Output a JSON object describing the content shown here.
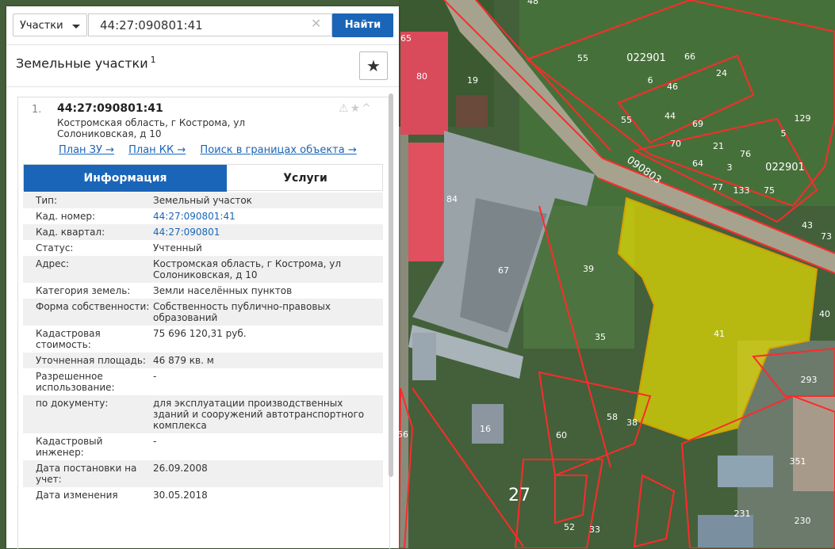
{
  "search": {
    "type_label": "Участки",
    "value": "44:27:090801:41",
    "find_label": "Найти"
  },
  "section": {
    "title": "Земельные участки",
    "count": "1"
  },
  "result": {
    "index": "1.",
    "cad_number": "44:27:090801:41",
    "address": "Костромская область, г Кострома, ул Солониковская, д 10",
    "links": [
      "План ЗУ →",
      "План КК →",
      "Поиск в границах объекта →"
    ]
  },
  "tabs": {
    "info": "Информация",
    "services": "Услуги"
  },
  "attributes": [
    {
      "k": "Тип:",
      "v": "Земельный участок"
    },
    {
      "k": "Кад. номер:",
      "v": "44:27:090801:41"
    },
    {
      "k": "Кад. квартал:",
      "v": "44:27:090801"
    },
    {
      "k": "Статус:",
      "v": "Учтенный"
    },
    {
      "k": "Адрес:",
      "v": "Костромская область, г Кострома, ул Солониковская, д 10"
    },
    {
      "k": "Категория земель:",
      "v": "Земли населённых пунктов"
    },
    {
      "k": "Форма собственности:",
      "v": "Собственность публично-правовых образований"
    },
    {
      "k": "Кадастровая стоимость:",
      "v": "75 696 120,31 руб."
    },
    {
      "k": "Уточненная площадь:",
      "v": "46 879 кв. м"
    },
    {
      "k": "Разрешенное использование:",
      "v": "-"
    },
    {
      "k": "по документу:",
      "v": "для эксплуатации производственных зданий и сооружений автотранспортного комплекса"
    },
    {
      "k": "Кадастровый инженер:",
      "v": "-"
    },
    {
      "k": "Дата постановки на учет:",
      "v": "26.09.2008"
    },
    {
      "k": "Дата изменения",
      "v": "30.05.2018"
    }
  ],
  "map_labels": {
    "parcel_selected": "41",
    "quarter_1": "022901",
    "quarter_2": "022901",
    "quarter_road": "090803",
    "big_27": "27",
    "plots": [
      "48",
      "65",
      "80",
      "19",
      "55",
      "66",
      "24",
      "6",
      "46",
      "44",
      "69",
      "55",
      "70",
      "21",
      "64",
      "76",
      "129",
      "5",
      "3",
      "77",
      "133",
      "75",
      "43",
      "73",
      "84",
      "67",
      "39",
      "35",
      "40",
      "293",
      "58",
      "38",
      "16",
      "60",
      "351",
      "33",
      "52",
      "56",
      "231",
      "230"
    ]
  },
  "colors": {
    "accent": "#1a65b7",
    "selected_parcel": "#e8e000",
    "boundary": "#ff2a2a"
  }
}
